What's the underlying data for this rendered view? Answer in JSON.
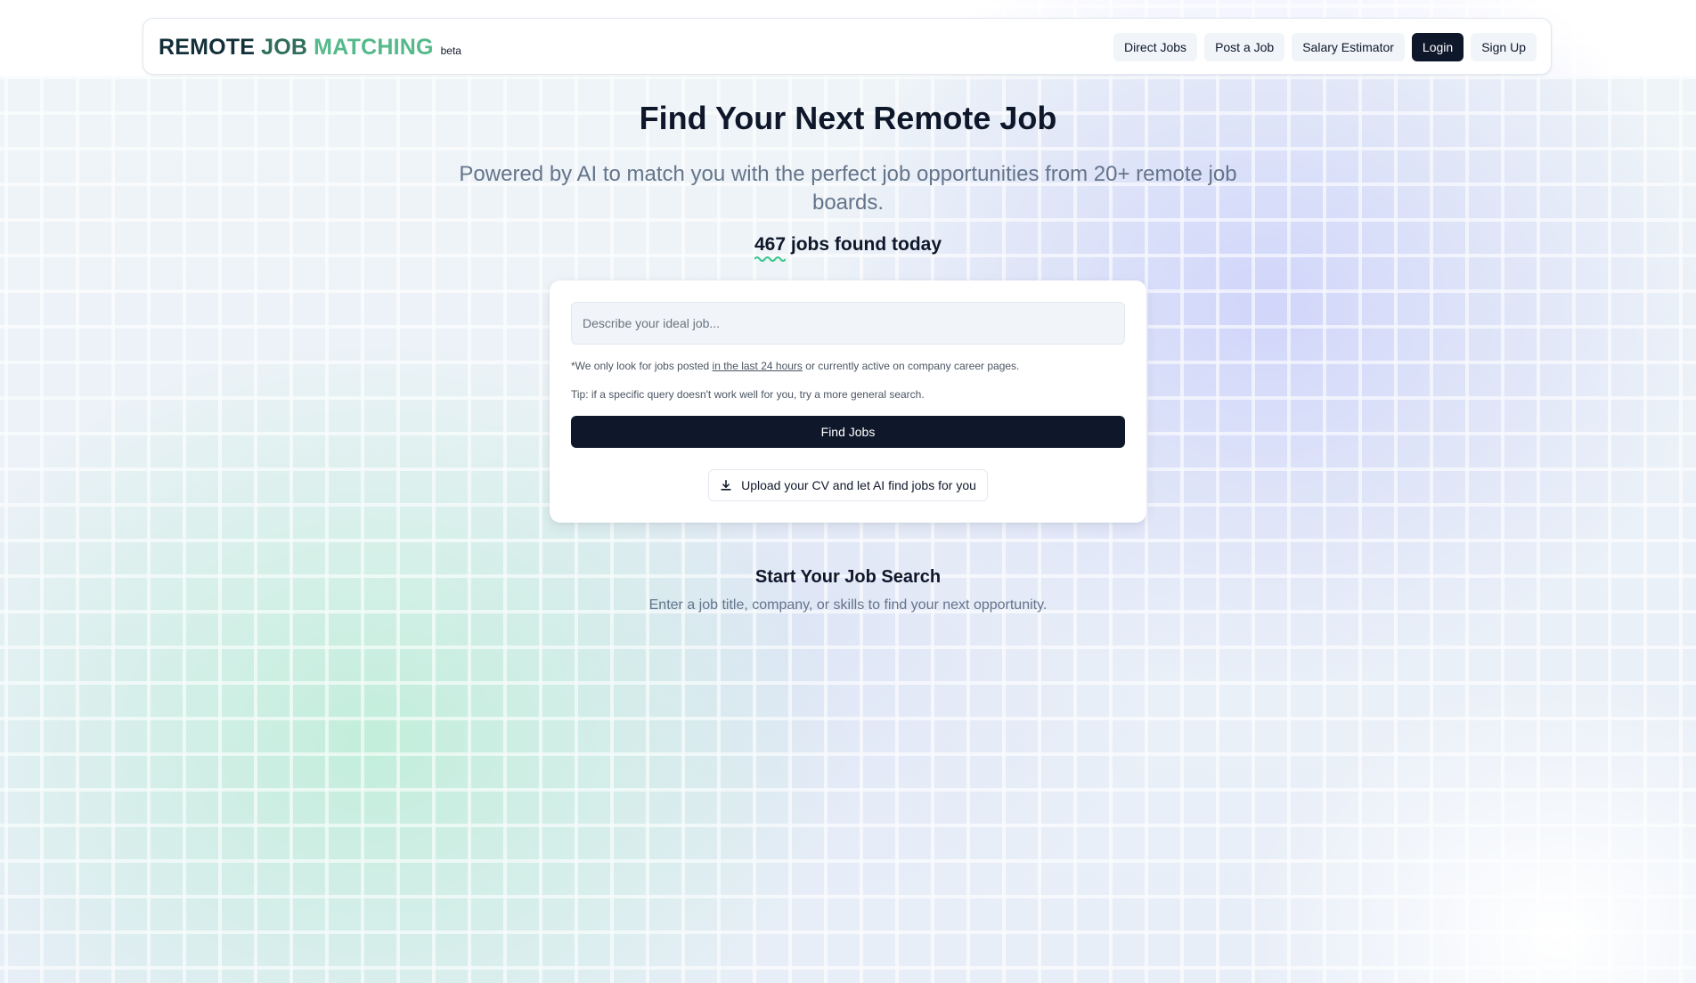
{
  "header": {
    "logo": {
      "word1": "REMOTE",
      "word2": "JOB",
      "word3": "MATCHING",
      "badge": "beta"
    },
    "nav": [
      {
        "label": "Direct Jobs"
      },
      {
        "label": "Post a Job"
      },
      {
        "label": "Salary Estimator"
      },
      {
        "label": "Login"
      },
      {
        "label": "Sign Up"
      }
    ]
  },
  "hero": {
    "title": "Find Your Next Remote Job",
    "subtitle": "Powered by AI to match you with the perfect job opportunities from 20+ remote job boards.",
    "jobs_count": "467",
    "jobs_count_suffix": " jobs found today"
  },
  "search": {
    "placeholder": "Describe your ideal job...",
    "note_prefix": "*We only look for jobs posted ",
    "note_link": "in the last 24 hours",
    "note_suffix": " or currently active on company career pages.",
    "tip": "Tip: if a specific query doesn't work well for you, try a more general search.",
    "find_label": "Find Jobs",
    "upload_label": "Upload your CV and let AI find jobs for you",
    "upload_icon": "download-icon"
  },
  "empty_state": {
    "title": "Start Your Job Search",
    "subtitle": "Enter a job title, company, or skills to find your next opportunity."
  },
  "colors": {
    "primary": "#0f172a",
    "logo_dark": "#13303a",
    "logo_mid": "#2f6e5b",
    "logo_light": "#55b98a",
    "squiggle": "#34c78a",
    "muted_text": "#64748b"
  }
}
